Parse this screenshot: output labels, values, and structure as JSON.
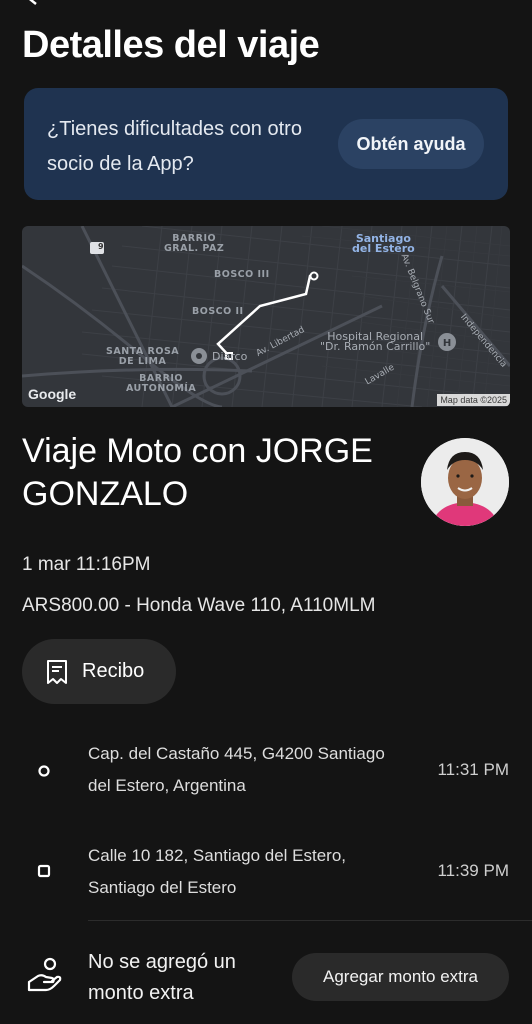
{
  "header": {
    "title": "Detalles del viaje"
  },
  "help": {
    "text": "¿Tienes dificultades con otro socio de la App?",
    "button_label": "Obtén ayuda"
  },
  "map": {
    "labels": {
      "barrio_gral_paz": "BARRIO\nGRAL. PAZ",
      "santiago": "Santiago\ndel Estero",
      "bosco_iii": "BOSCO III",
      "bosco_ii": "BOSCO II",
      "santa_rosa": "SANTA ROSA\nDE LIMA",
      "barrio_autonomia": "BARRIO\nAUTONOMÍA",
      "hospital": "Hospital Regional\n\"Dr. Ramón Carrillo\"",
      "av_libertad": "Av. Libertad",
      "av_belgrano": "Av. Belgrano Sur",
      "independencia": "Independencia",
      "lavalle": "Lavalle",
      "diarco": "Diarco",
      "route_badge": "9"
    },
    "google_logo": "Google",
    "attribution": "Map data ©2025"
  },
  "trip": {
    "title": "Viaje Moto con JORGE GONZALO",
    "date": "1 mar 11:16PM",
    "fare": "ARS800.00 - Honda Wave 110, A110MLM"
  },
  "receipt": {
    "label": "Recibo"
  },
  "stops": [
    {
      "address": "Cap. del Castaño 445, G4200 Santiago del Estero, Argentina",
      "time": "11:31 PM"
    },
    {
      "address": "Calle 10 182, Santiago del Estero, Santiago del Estero",
      "time": "11:39 PM"
    }
  ],
  "tip": {
    "text": "No se agregó un monto extra",
    "button_label": "Agregar monto extra"
  },
  "colors": {
    "background": "#141414",
    "help_card": "#1f3350",
    "help_button": "#2b4263",
    "pill": "#2a2a2a",
    "route": "#ffffff"
  }
}
